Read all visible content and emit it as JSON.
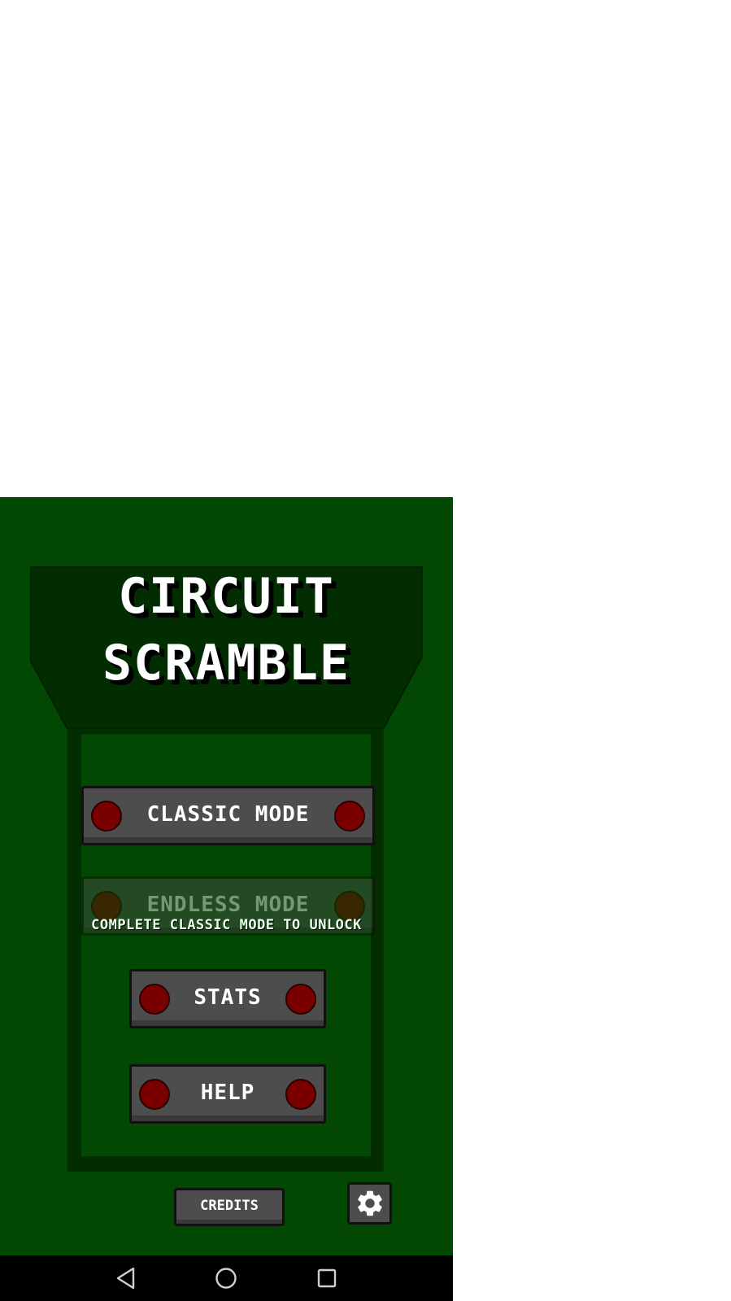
{
  "title": {
    "line1": "CIRCUIT",
    "line2": "SCRAMBLE"
  },
  "menu": {
    "classic_label": "CLASSIC MODE",
    "endless_label": "ENDLESS MODE",
    "endless_locked": true,
    "unlock_note": "COMPLETE CLASSIC MODE TO UNLOCK",
    "stats_label": "STATS",
    "help_label": "HELP",
    "credits_label": "CREDITS",
    "settings_icon": "gear-icon"
  },
  "navbar": {
    "back_icon": "back-triangle-icon",
    "home_icon": "home-circle-icon",
    "recents_icon": "recents-square-icon"
  },
  "colors": {
    "background_green": "#024802",
    "bezel_dark_green": "#012a01",
    "button_gray": "#4d4d4d",
    "led_red": "#7a0000"
  }
}
